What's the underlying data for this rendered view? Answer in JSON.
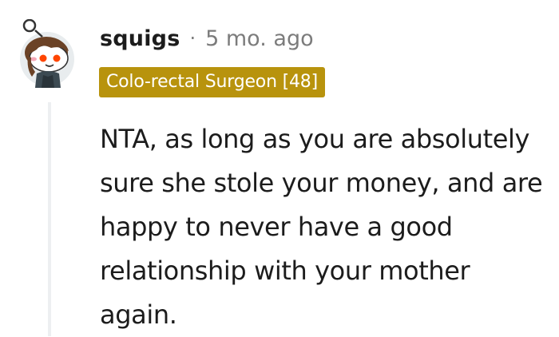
{
  "comment": {
    "username": "squigs",
    "separator": "·",
    "timestamp": "5 mo. ago",
    "flair": "Colo-rectal Surgeon [48]",
    "flair_color": "#b8930d",
    "body": "NTA, as long as you are absolutely sure she stole your money, and are happy to never have a good relationship with your mother again.",
    "avatar_icon": "reddit-snoo-avatar-icon"
  }
}
